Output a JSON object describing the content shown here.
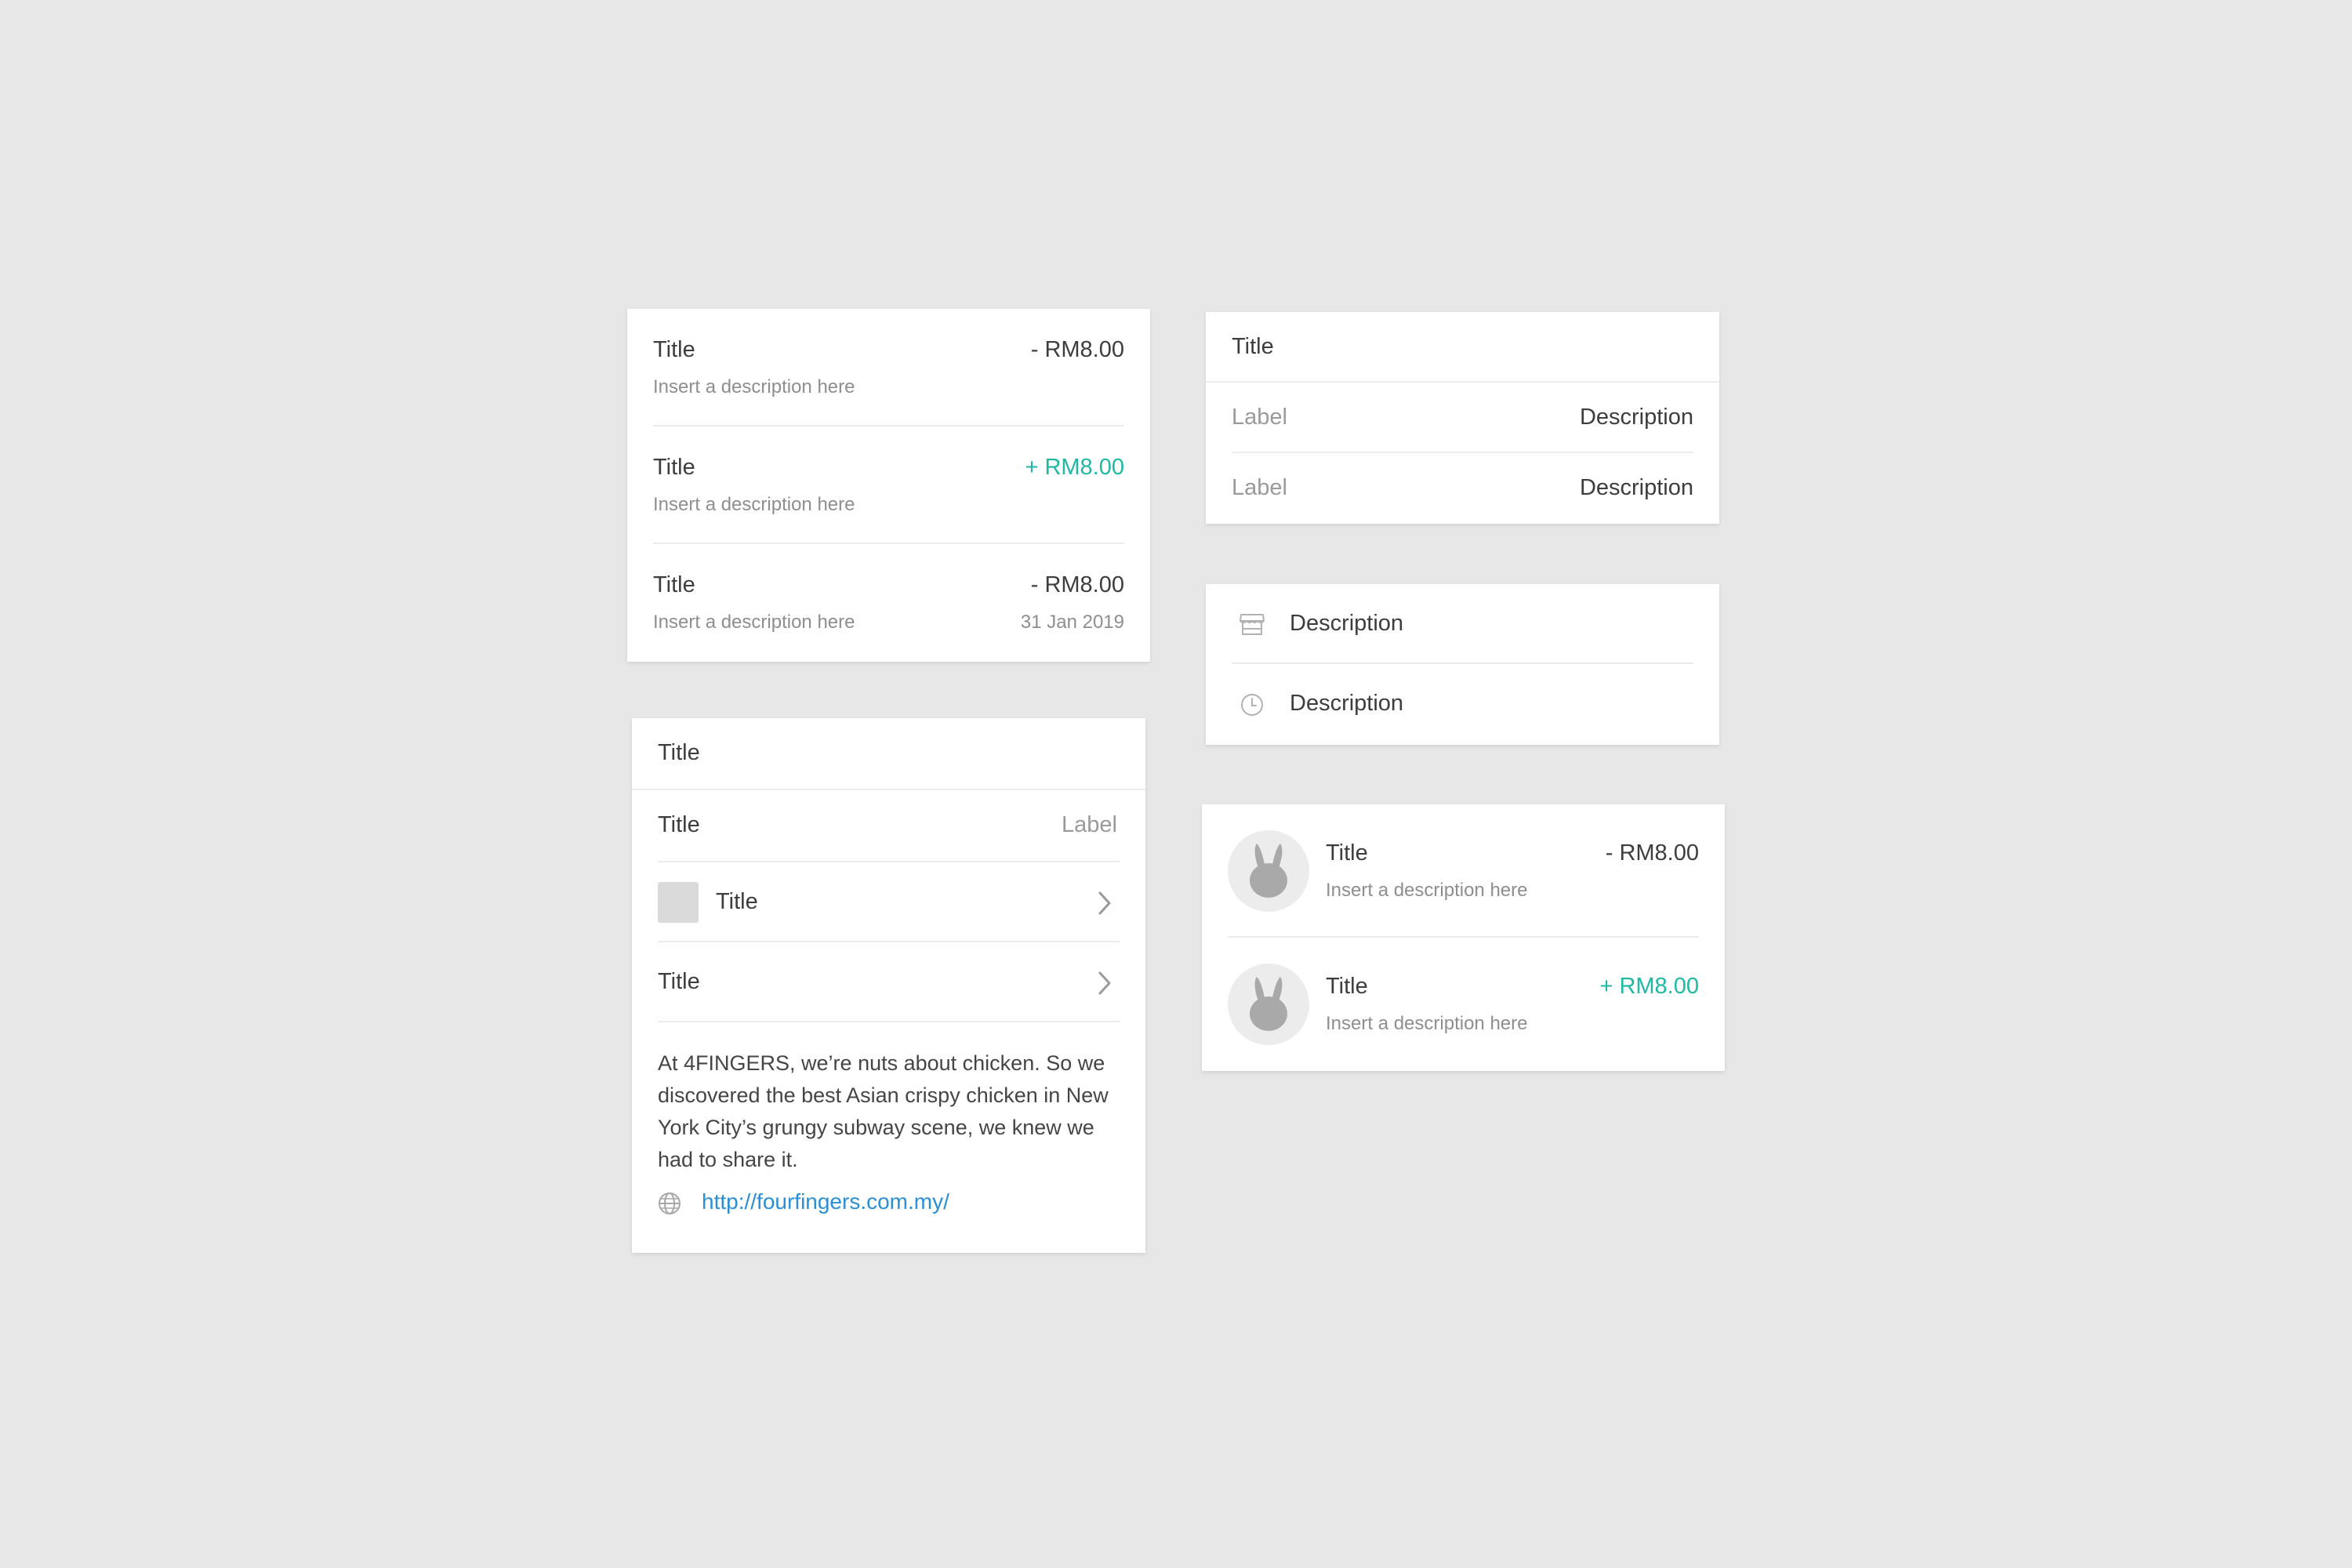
{
  "transactions_card": {
    "rows": [
      {
        "title": "Title",
        "description": "Insert a description here",
        "amount": "- RM8.00",
        "sign": "negative"
      },
      {
        "title": "Title",
        "description": "Insert a description here",
        "amount": "+ RM8.00",
        "sign": "positive"
      },
      {
        "title": "Title",
        "description": "Insert a description here",
        "amount": "- RM8.00",
        "date": "31 Jan 2019",
        "sign": "negative"
      }
    ]
  },
  "detail_card": {
    "header_title": "Title",
    "rows": [
      {
        "title": "Title",
        "label": "Label"
      },
      {
        "title": "Title",
        "icon": "thumbnail-placeholder",
        "action": "chevron-right-icon"
      },
      {
        "title": "Title",
        "action": "chevron-right-icon"
      }
    ],
    "paragraph": "At 4FINGERS, we’re nuts about chicken. So we discovered the best Asian crispy chicken in New York City’s grungy subway scene, we knew we had to share it.",
    "link": {
      "icon": "globe-icon",
      "text": "http://fourfingers.com.my/"
    }
  },
  "label_card": {
    "header_title": "Title",
    "rows": [
      {
        "label": "Label",
        "value": "Description"
      },
      {
        "label": "Label",
        "value": "Description"
      }
    ]
  },
  "icon_list_card": {
    "rows": [
      {
        "icon": "store-icon",
        "text": "Description"
      },
      {
        "icon": "clock-icon",
        "text": "Description"
      }
    ]
  },
  "avatar_card": {
    "rows": [
      {
        "avatar": "rabbit-avatar-icon",
        "title": "Title",
        "description": "Insert a description here",
        "amount": "- RM8.00",
        "sign": "negative"
      },
      {
        "avatar": "rabbit-avatar-icon",
        "title": "Title",
        "description": "Insert a description here",
        "amount": "+ RM8.00",
        "sign": "positive"
      }
    ]
  },
  "colors": {
    "background": "#e7e7e7",
    "card": "#ffffff",
    "positive_amount": "#1fb9a3",
    "link": "#2a8fd6",
    "divider": "#ececec"
  }
}
